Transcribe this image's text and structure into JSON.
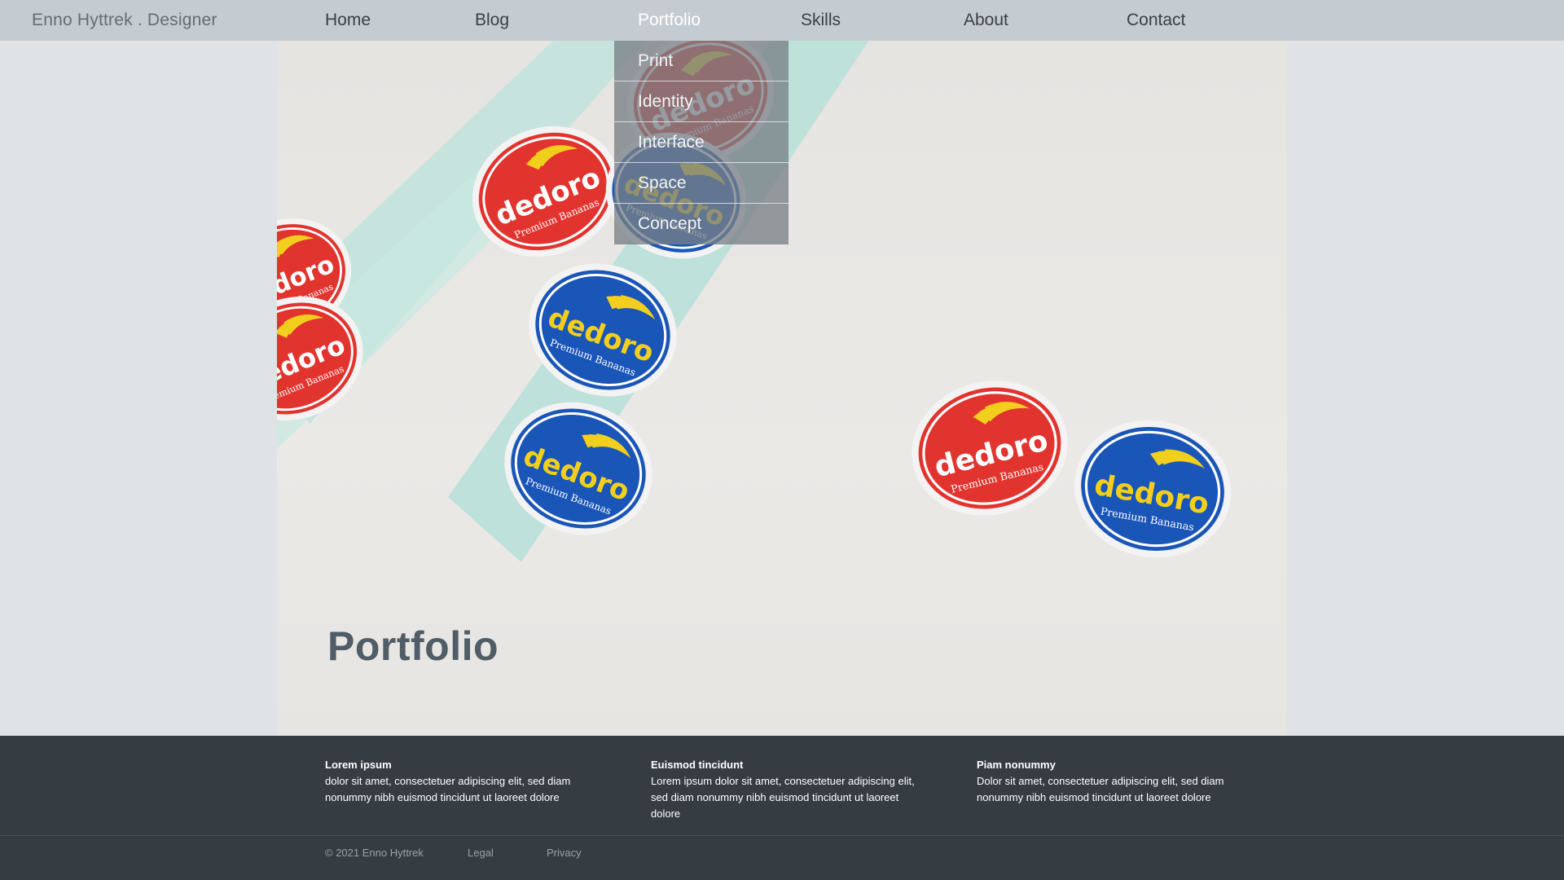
{
  "header": {
    "brand": "Enno Hyttrek . Designer",
    "nav": [
      {
        "label": "Home"
      },
      {
        "label": "Blog"
      },
      {
        "label": "Portfolio"
      },
      {
        "label": "Skills"
      },
      {
        "label": "About"
      },
      {
        "label": "Contact"
      }
    ],
    "active_nav": "Portfolio"
  },
  "dropdown": {
    "items": [
      {
        "label": "Print"
      },
      {
        "label": "Identity"
      },
      {
        "label": "Interface"
      },
      {
        "label": "Space"
      },
      {
        "label": "Concept"
      }
    ]
  },
  "hero": {
    "title": "Portfolio",
    "sticker_brand": "dedoro",
    "sticker_tagline": "Premium Bananas"
  },
  "footer": {
    "columns": [
      {
        "heading": "Lorem ipsum",
        "text": "dolor sit amet, consectetuer adipiscing elit, sed diam nonummy nibh euismod tincidunt ut laoreet dolore"
      },
      {
        "heading": "Euismod tincidunt",
        "text": "Lorem ipsum dolor sit amet, consectetuer adipiscing elit, sed diam nonummy nibh euismod tincidunt ut laoreet dolore"
      },
      {
        "heading": "Piam nonummy",
        "text": "Dolor sit amet, consectetuer adipiscing elit, sed diam nonummy nibh euismod tincidunt ut laoreet dolore"
      }
    ],
    "copyright": "© 2021 Enno Hyttrek",
    "links": [
      {
        "label": "Legal"
      },
      {
        "label": "Privacy"
      }
    ]
  },
  "colors": {
    "topbar": "#c5ccd1",
    "footer": "#353c42",
    "sticker_red": "#e2342f",
    "sticker_blue": "#1a55b8",
    "banana_yellow": "#f2cf1d"
  }
}
